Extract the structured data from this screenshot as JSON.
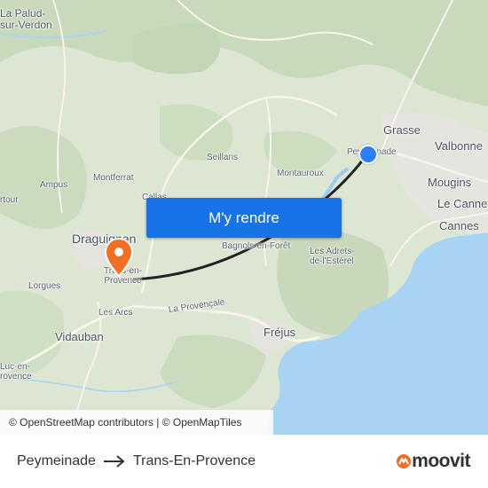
{
  "map": {
    "places": [
      {
        "id": "la-palud",
        "text": "La Palud-\nsur-Verdon"
      },
      {
        "id": "grasse",
        "text": "Grasse"
      },
      {
        "id": "valbonne",
        "text": "Valbonne"
      },
      {
        "id": "peymeinade",
        "text": "Peymeinade"
      },
      {
        "id": "seillans",
        "text": "Seillans"
      },
      {
        "id": "montauroux",
        "text": "Montauroux"
      },
      {
        "id": "montferrat",
        "text": "Montferrat"
      },
      {
        "id": "ampus",
        "text": "Ampus"
      },
      {
        "id": "callas",
        "text": "Callas"
      },
      {
        "id": "mougins",
        "text": "Mougins"
      },
      {
        "id": "le-cannet",
        "text": "Le Cannet"
      },
      {
        "id": "cannes",
        "text": "Cannes"
      },
      {
        "id": "draguignan",
        "text": "Draguignan"
      },
      {
        "id": "bagnols",
        "text": "Bagnols-en-Forêt"
      },
      {
        "id": "adrets",
        "text": "Les Adrets-\nde-l'Estérel"
      },
      {
        "id": "trans",
        "text": "Trans-en-\nProvence"
      },
      {
        "id": "lorgues",
        "text": "Lorgues"
      },
      {
        "id": "les-arcs",
        "text": "Les Arcs"
      },
      {
        "id": "la-provencale",
        "text": "La Provençale"
      },
      {
        "id": "frejus",
        "text": "Fréjus"
      },
      {
        "id": "vidauban",
        "text": "Vidauban"
      },
      {
        "id": "luc",
        "text": "Luc-en-\nrovence"
      },
      {
        "id": "artour",
        "text": "rtour"
      }
    ],
    "cta_label": "M'y rendre",
    "attribution": "© OpenStreetMap contributors | © OpenMapTiles",
    "colors": {
      "land": "#dfe6d6",
      "forest": "#c9dcbc",
      "sea": "#a9d3f2",
      "route": "#222222",
      "button": "#1873e8",
      "pin": "#f26e22",
      "origin_dot": "#2d7ff9"
    }
  },
  "footer": {
    "origin": "Peymeinade",
    "destination": "Trans-En-Provence",
    "brand": "moovit"
  }
}
